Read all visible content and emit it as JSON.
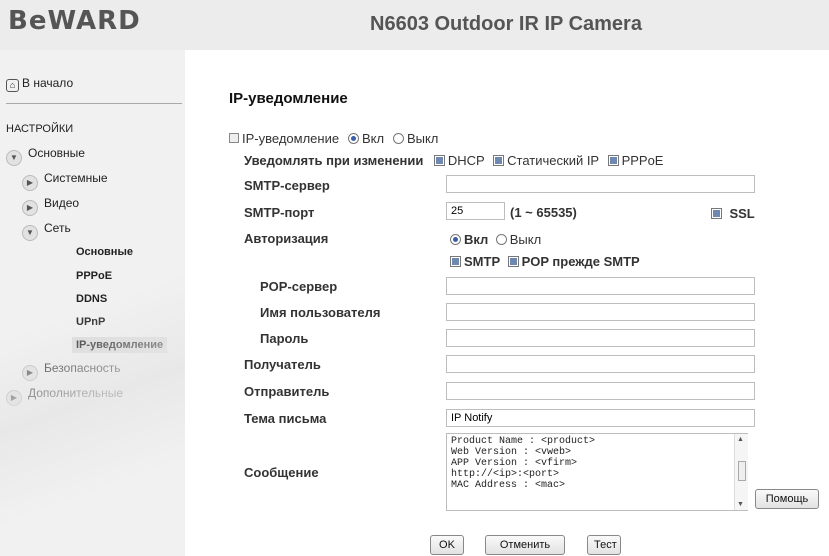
{
  "header": {
    "logo": "BeWARD",
    "camera_title": "N6603 Outdoor IR IP Camera"
  },
  "sidebar": {
    "home": "В начало",
    "section_title": "НАСТРОЙКИ",
    "items": [
      {
        "label": "Основные"
      },
      {
        "label": "Системные"
      },
      {
        "label": "Видео"
      },
      {
        "label": "Сеть"
      },
      {
        "label": "Основные"
      },
      {
        "label": "PPPoE"
      },
      {
        "label": "DDNS"
      },
      {
        "label": "UPnP"
      },
      {
        "label": "IP-уведомление"
      },
      {
        "label": "Безопасность"
      },
      {
        "label": "Дополнительные"
      }
    ]
  },
  "main": {
    "title": "IP-уведомление",
    "enable": {
      "label": "IP-уведомление",
      "on": "Вкл",
      "off": "Выкл",
      "value": "on"
    },
    "notify_on_change": {
      "label": "Уведомлять при изменении",
      "dhcp": "DHCP",
      "static": "Статический IP",
      "pppoe": "PPPoE"
    },
    "smtp_server": {
      "label": "SMTP-сервер",
      "value": ""
    },
    "smtp_port": {
      "label": "SMTP-порт",
      "value": "25",
      "range": "(1 ~ 65535)",
      "ssl": "SSL"
    },
    "auth": {
      "label": "Авторизация",
      "on": "Вкл",
      "off": "Выкл",
      "value": "on",
      "smtp": "SMTP",
      "pop_before": "POP прежде SMTP"
    },
    "pop_server": {
      "label": "POP-сервер",
      "value": ""
    },
    "username": {
      "label": "Имя пользователя",
      "value": ""
    },
    "password": {
      "label": "Пароль",
      "value": ""
    },
    "recipient": {
      "label": "Получатель",
      "value": ""
    },
    "sender": {
      "label": "Отправитель",
      "value": ""
    },
    "subject": {
      "label": "Тема письма",
      "value": "IP Notify"
    },
    "message": {
      "label": "Сообщение",
      "value": "Product Name : <product>\nWeb Version : <vweb>\nAPP Version : <vfirm>\nhttp://<ip>:<port>\nMAC Address : <mac>"
    },
    "help_button": "Помощь",
    "ok_button": "OK",
    "cancel_button": "Отменить",
    "test_button": "Тест"
  }
}
